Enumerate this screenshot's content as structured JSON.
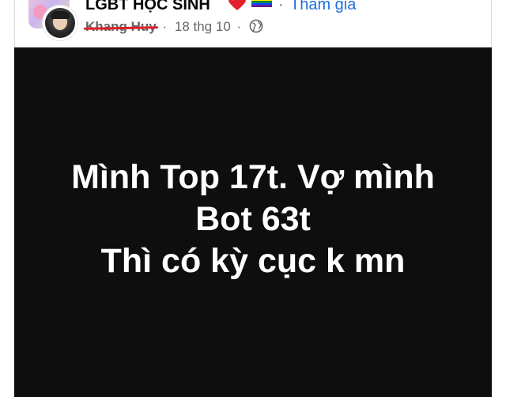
{
  "header": {
    "group_name": "LGBT HỌC SINH",
    "join_separator": "·",
    "join_label": "Tham gia",
    "group_avatar_icon": "group-avatar-image",
    "user_avatar_icon": "user-avatar-image",
    "heart_icon": "red-heart-icon",
    "heart_color": "#e0202a",
    "rainbow_icon": "rainbow-flag-icon"
  },
  "meta": {
    "author": "Khang Huy",
    "author_strikethrough": true,
    "strike_color": "#e0202a",
    "date": "18 thg 10",
    "separator": "·",
    "privacy_icon": "globe-icon"
  },
  "post": {
    "background_color": "#0e0e0e",
    "text_color": "#ffffff",
    "lines": [
      "Mình Top 17t. Vợ mình",
      "Bot 63t",
      "Thì có kỳ cục k mn"
    ]
  }
}
